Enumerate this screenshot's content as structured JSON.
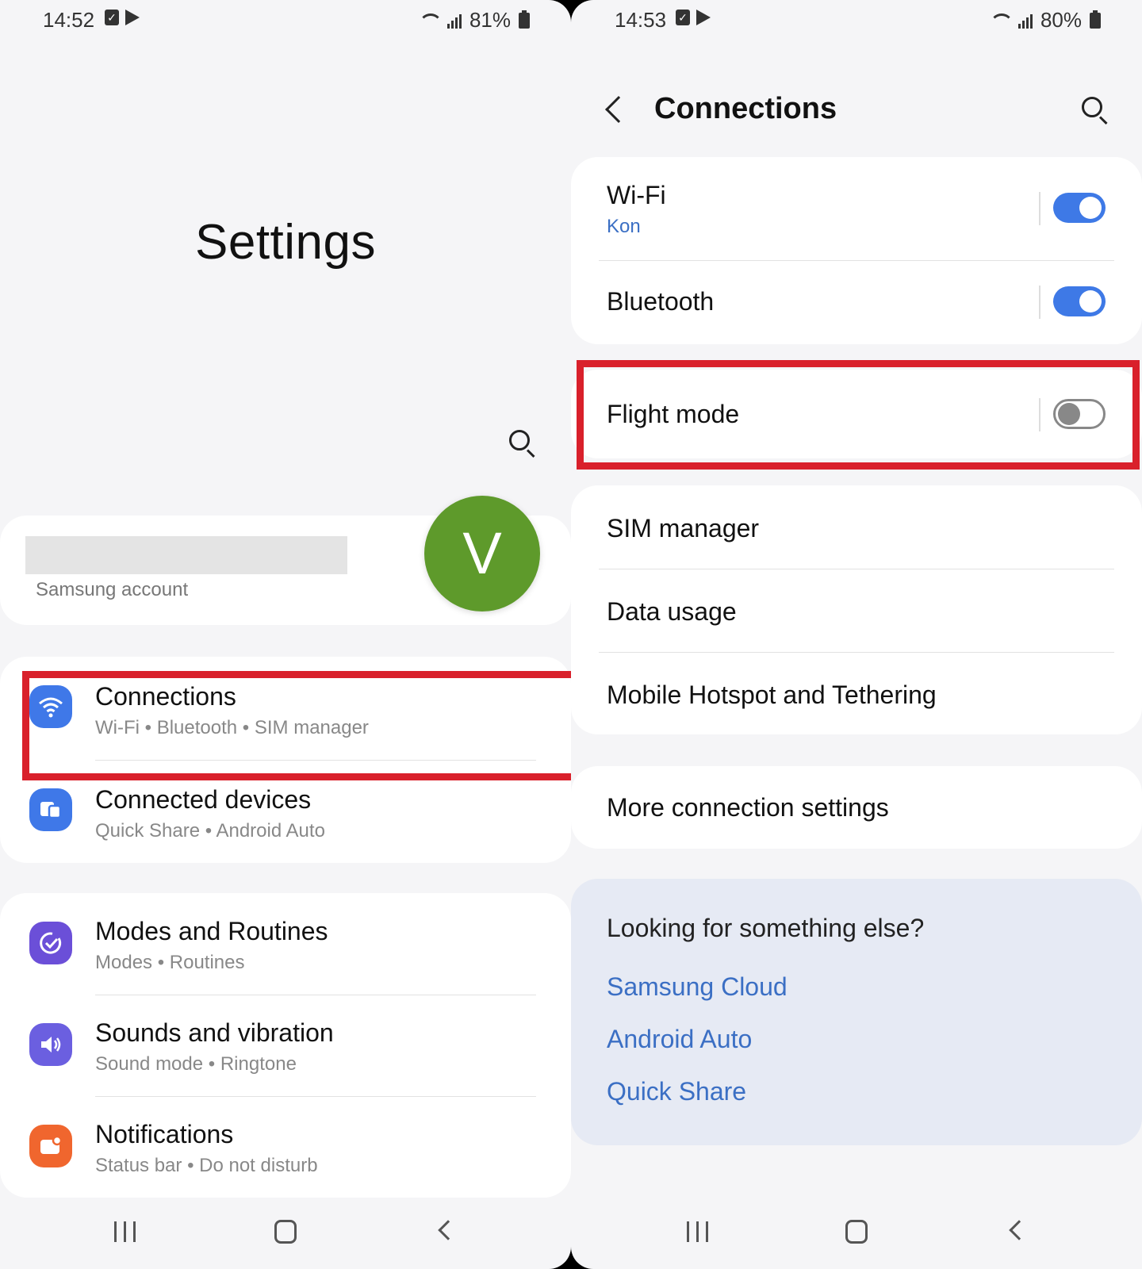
{
  "left_screen": {
    "status": {
      "time": "14:52",
      "battery": "81%"
    },
    "title": "Settings",
    "account": {
      "avatar_letter": "V",
      "label": "Samsung account"
    },
    "menu": [
      {
        "title": "Connections",
        "subtitle": "Wi-Fi  •  Bluetooth  •  SIM manager",
        "icon": "wifi-icon",
        "color": "#3f78e8"
      },
      {
        "title": "Connected devices",
        "subtitle": "Quick Share  •  Android Auto",
        "icon": "devices-icon",
        "color": "#3f78e8"
      },
      {
        "title": "Modes and Routines",
        "subtitle": "Modes  •  Routines",
        "icon": "routine-check-icon",
        "color": "#6b4fd8"
      },
      {
        "title": "Sounds and vibration",
        "subtitle": "Sound mode  •  Ringtone",
        "icon": "speaker-icon",
        "color": "#6b5fe0"
      },
      {
        "title": "Notifications",
        "subtitle": "Status bar  •  Do not disturb",
        "icon": "notification-icon",
        "color": "#f0662e"
      }
    ]
  },
  "right_screen": {
    "status": {
      "time": "14:53",
      "battery": "80%"
    },
    "header": {
      "title": "Connections"
    },
    "wifi": {
      "title": "Wi-Fi",
      "network": "Kon",
      "enabled": true
    },
    "bluetooth": {
      "title": "Bluetooth",
      "enabled": true
    },
    "flight_mode": {
      "title": "Flight mode",
      "enabled": false
    },
    "sim_manager": "SIM manager",
    "data_usage": "Data usage",
    "hotspot": "Mobile Hotspot and Tethering",
    "more_settings": "More connection settings",
    "suggestions": {
      "title": "Looking for something else?",
      "links": [
        "Samsung Cloud",
        "Android Auto",
        "Quick Share"
      ]
    }
  },
  "colors": {
    "accent": "#3e79e6",
    "highlight": "#d9202b",
    "link": "#3b6fc4"
  }
}
